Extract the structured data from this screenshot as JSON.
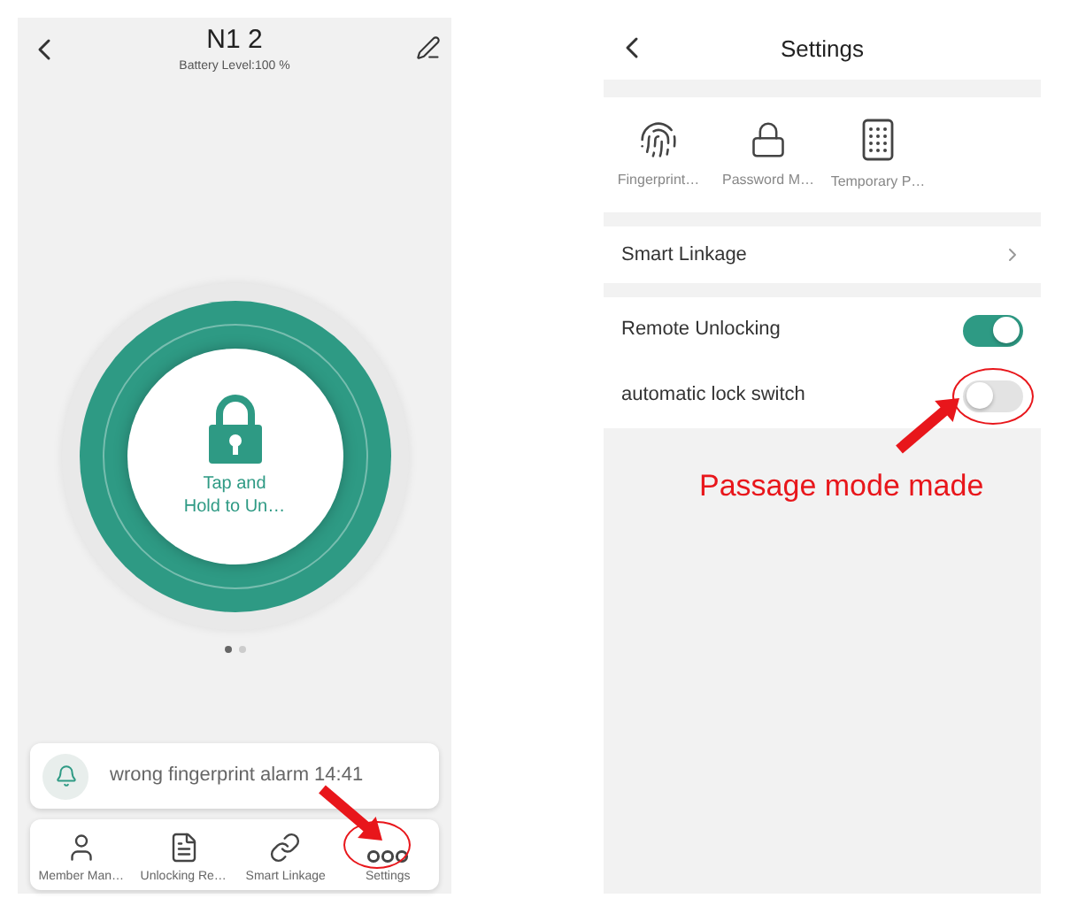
{
  "lock_screen": {
    "header": {
      "title": "N1 2",
      "subtitle": "Battery Level:100 %"
    },
    "unlock_button": {
      "lines": [
        "Tap and",
        "Hold to Un…"
      ]
    },
    "pager": [
      {
        "selected": true
      },
      {
        "selected": false
      }
    ],
    "notification": {
      "text": "wrong fingerprint alarm 14:41"
    },
    "nav": [
      {
        "label": "Member Man…",
        "kind": "person",
        "circled": false
      },
      {
        "label": "Unlocking Re…",
        "kind": "document",
        "circled": false
      },
      {
        "label": "Smart Linkage",
        "kind": "link",
        "circled": false
      },
      {
        "label": "Settings",
        "kind": "more",
        "circled": true
      }
    ]
  },
  "settings_screen": {
    "header": {
      "title": "Settings"
    },
    "shortcuts": [
      {
        "label": "Fingerprint…",
        "kind": "fingerprint"
      },
      {
        "label": "Password M…",
        "kind": "lock"
      },
      {
        "label": "Temporary P…",
        "kind": "keypad"
      }
    ],
    "link_row": {
      "label": "Smart Linkage"
    },
    "toggles": [
      {
        "label": "Remote Unlocking",
        "on": true,
        "circled": false
      },
      {
        "label": "automatic lock switch",
        "on": false,
        "circled": true
      }
    ],
    "annotation_note": "Passage mode made"
  }
}
